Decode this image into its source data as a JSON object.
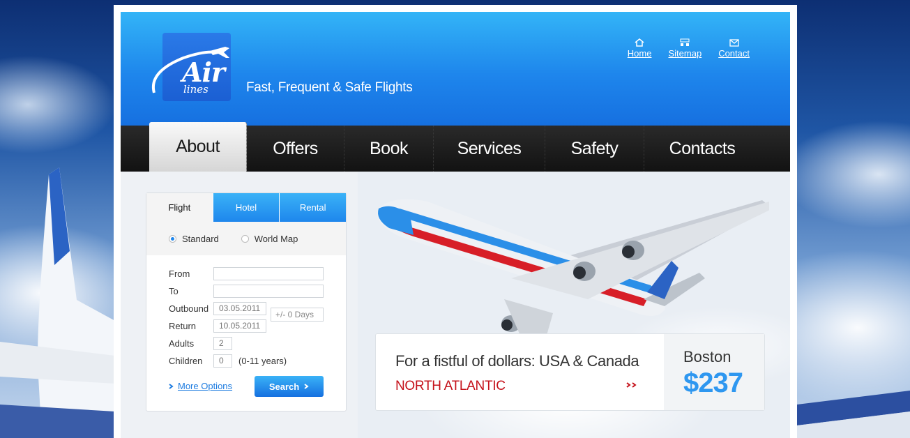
{
  "brand": {
    "logo_main": "Air",
    "logo_sub": "lines",
    "tagline": "Fast, Frequent & Safe Flights"
  },
  "top_links": [
    {
      "label": "Home",
      "icon": "home-icon"
    },
    {
      "label": "Sitemap",
      "icon": "sitemap-icon"
    },
    {
      "label": "Contact",
      "icon": "envelope-icon"
    }
  ],
  "nav": [
    "About",
    "Offers",
    "Book",
    "Services",
    "Safety",
    "Contacts"
  ],
  "booking": {
    "tabs": [
      "Flight",
      "Hotel",
      "Rental"
    ],
    "radio": {
      "standard": "Standard",
      "world_map": "World Map"
    },
    "fields": {
      "from": {
        "label": "From",
        "value": ""
      },
      "to": {
        "label": "To",
        "value": ""
      },
      "outbound": {
        "label": "Outbound",
        "value": "03.05.2011"
      },
      "return": {
        "label": "Return",
        "value": "10.05.2011"
      },
      "adults": {
        "label": "Adults",
        "value": "2"
      },
      "children": {
        "label": "Children",
        "value": "0",
        "note": "(0-11 years)"
      }
    },
    "days_range": "+/- 0 Days",
    "more_options": "More Options",
    "search": "Search"
  },
  "promo": {
    "title": "For a fistful of dollars: USA & Canada",
    "subtitle": "NORTH ATLANTIC",
    "city": "Boston",
    "price": "$237"
  },
  "colors": {
    "accent": "#1e86ec",
    "nav_bg": "#1a1a1a",
    "promo_red": "#c5121b",
    "price_blue": "#2e97f0"
  }
}
